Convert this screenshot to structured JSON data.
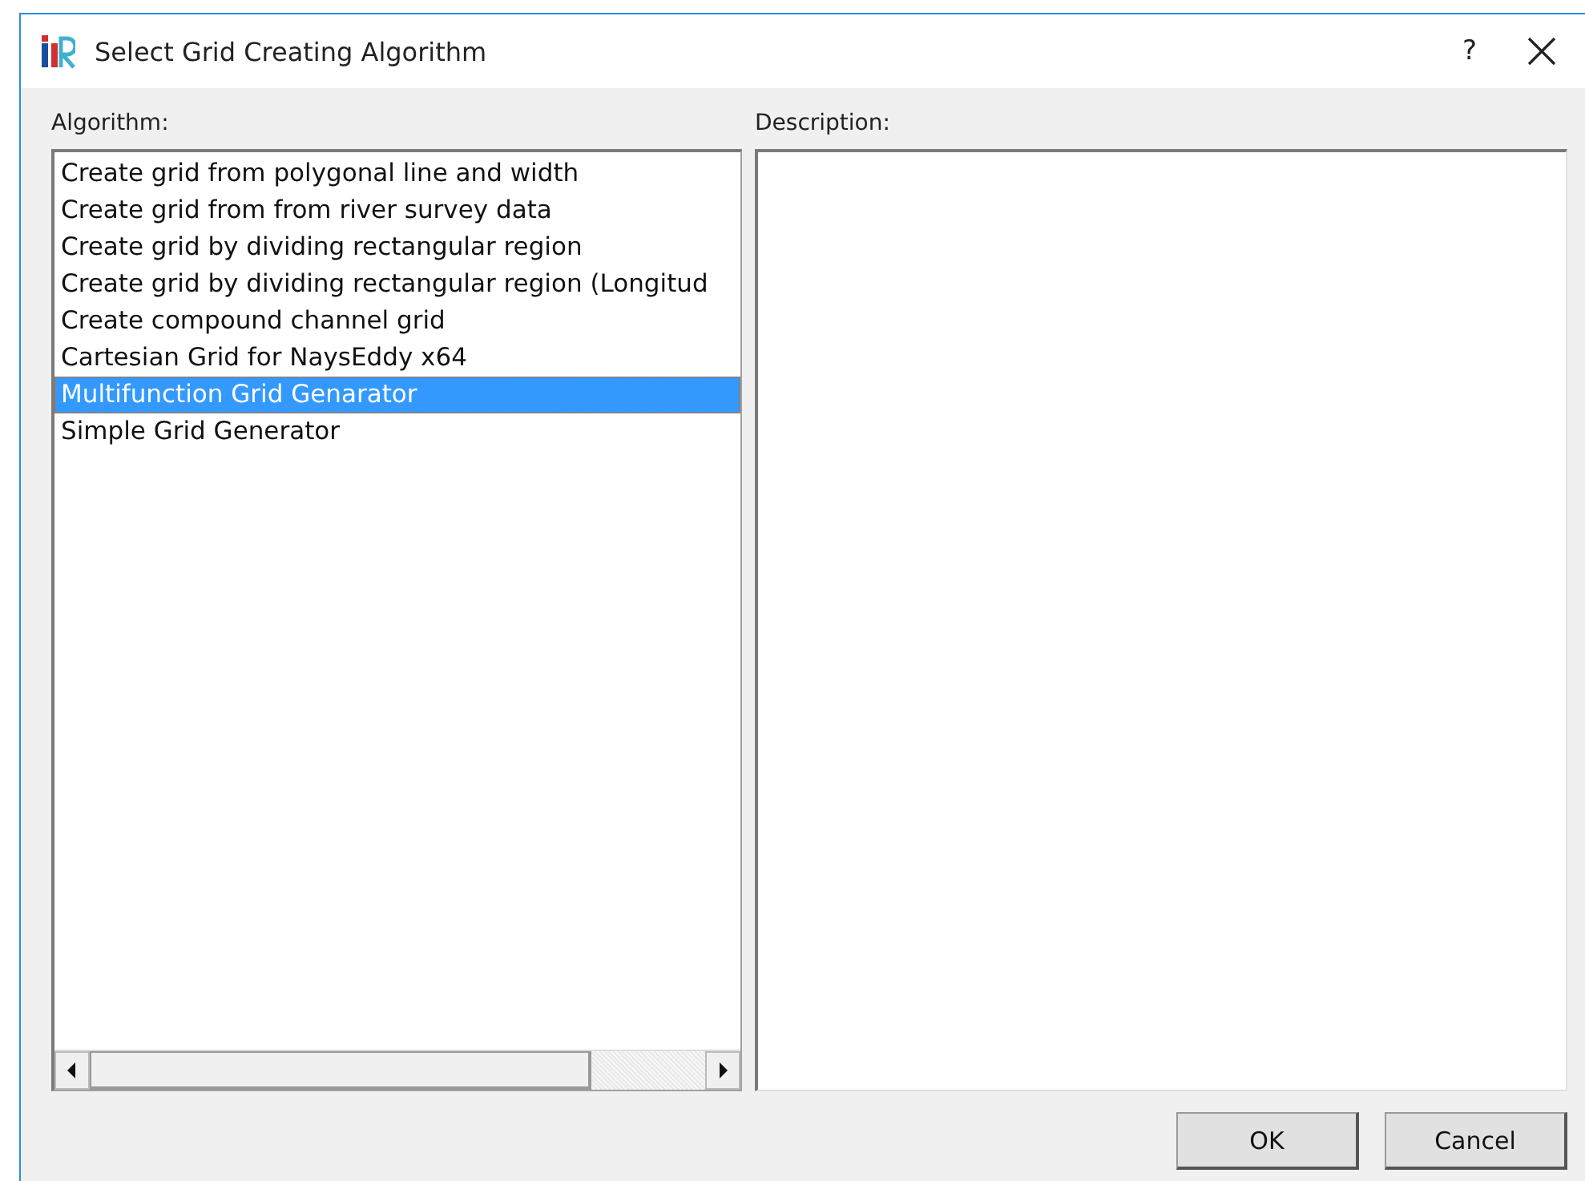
{
  "window": {
    "title": "Select Grid Creating Algorithm",
    "help": "?"
  },
  "algorithm": {
    "label": "Algorithm:",
    "items": [
      {
        "label": "Create grid from polygonal line and width",
        "selected": false
      },
      {
        "label": "Create grid from from river survey data",
        "selected": false
      },
      {
        "label": "Create grid by dividing rectangular region",
        "selected": false
      },
      {
        "label": "Create grid by dividing rectangular region (Longitud",
        "selected": false
      },
      {
        "label": "Create compound channel grid",
        "selected": false
      },
      {
        "label": "Cartesian Grid for NaysEddy x64",
        "selected": false
      },
      {
        "label": "Multifunction Grid Genarator",
        "selected": true
      },
      {
        "label": "Simple Grid Generator",
        "selected": false
      }
    ]
  },
  "description": {
    "label": "Description:"
  },
  "buttons": [
    "OK",
    "Cancel"
  ]
}
